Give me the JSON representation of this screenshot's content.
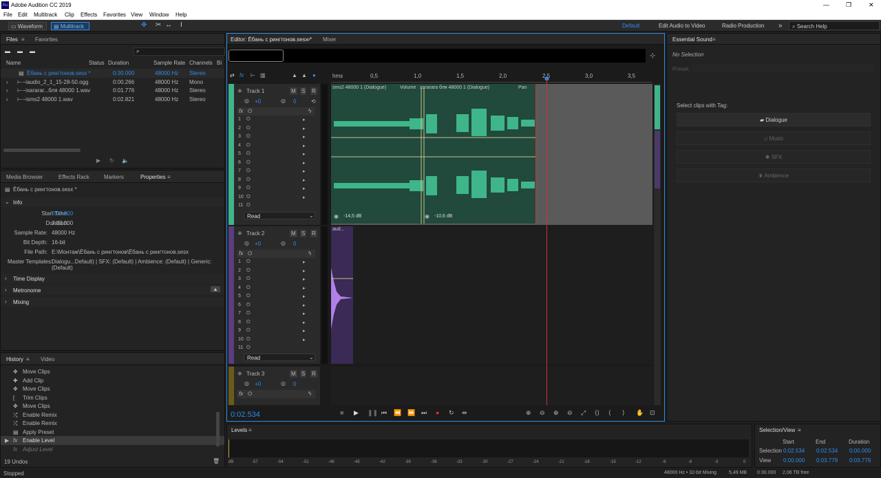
{
  "app": {
    "title": "Adobe Audition CC 2019",
    "logo_text": "Au",
    "window_controls": [
      "—",
      "❐",
      "✕"
    ]
  },
  "menu": [
    "File",
    "Edit",
    "Multitrack",
    "Clip",
    "Effects",
    "Favorites",
    "View",
    "Window",
    "Help"
  ],
  "toolbar": {
    "waveform": "Waveform",
    "multitrack": "Multitrack",
    "workspaces": [
      "Default",
      "Edit Audio to Video",
      "Radio Production"
    ],
    "more": "»",
    "search_placeholder": "Search Help"
  },
  "files": {
    "tabs": [
      "Files",
      "Favorites"
    ],
    "columns": [
      "Name",
      "Status",
      "Duration",
      "Sample Rate",
      "Channels",
      "Bi"
    ],
    "rows": [
      {
        "name": "Ёбань с рингтонов.sesx *",
        "duration": "0:30.000",
        "rate": "48000 Hz",
        "channels": "Stereo",
        "selected": true
      },
      {
        "name": "audio_2_1_15-28-50.ogg",
        "duration": "0:00.266",
        "rate": "48000 Hz",
        "channels": "Mono"
      },
      {
        "name": "хагаrаг...бля 48000 1.wav",
        "duration": "0:01.776",
        "rate": "48000 Hz",
        "channels": "Stereo"
      },
      {
        "name": "sms2 48000 1.wav",
        "duration": "0:02.821",
        "rate": "48000 Hz",
        "channels": "Stereo"
      }
    ]
  },
  "properties": {
    "tabs": [
      "Media Browser",
      "Effects Rack",
      "Markers",
      "Properties"
    ],
    "file": "Ёбань с рингтонов.sesx *",
    "section": "Info",
    "info": [
      [
        "Start Time:",
        "0:00.000"
      ],
      [
        "Duration:",
        "0:30.000"
      ],
      [
        "Sample Rate:",
        "48000 Hz"
      ],
      [
        "Bit Depth:",
        "16-bit"
      ],
      [
        "File Path:",
        "E:\\Монтаж\\Ёбань с рингтонов\\Ёбань с рингтонов.sesx"
      ],
      [
        "Master Templates:",
        "Dialogu...Default) | SFX: (Default) | Ambience: (Default) | Generic: (Default)"
      ]
    ],
    "collapsed": [
      "Time Display",
      "Metronome",
      "Mixing"
    ]
  },
  "history": {
    "tabs": [
      "History",
      "Video"
    ],
    "items": [
      "Move Clips",
      "Add Clip",
      "Move Clips",
      "Trim Clips",
      "Move Clips",
      "Enable Remix",
      "Enable Remix",
      "Apply Preset",
      "Enable Level",
      "Adjust Level"
    ],
    "undos": "19 Undos",
    "status": "Stopped"
  },
  "editor": {
    "tab": "Editor: Ёбань с рингтонов.sesx *",
    "mixer": "Mixer",
    "time": "0:02.534",
    "ruler": [
      "hms",
      "0,5",
      "1,0",
      "1,5",
      "2,0",
      "2,5",
      "3,0",
      "3,5"
    ],
    "tracks": [
      {
        "name": "Track 1",
        "vol": "+0",
        "pan": "0",
        "clip1": "sms2 48000 1 (Dialogue)",
        "volume_label": "Volume",
        "clip2": "хагаrаrа бля 48000 1 (Dialogue)",
        "pan_label": "Pan",
        "db1": "-14,5 dB",
        "db2": "-10,6 dB",
        "read": "Read"
      },
      {
        "name": "Track 2",
        "vol": "+0",
        "pan": "0",
        "clip1": "aud...",
        "read": "Read"
      },
      {
        "name": "Track 3",
        "vol": "+0",
        "pan": "0"
      }
    ],
    "rack": [
      "1",
      "2",
      "3",
      "4",
      "5",
      "6",
      "7",
      "8",
      "9",
      "10",
      "11"
    ],
    "msr": [
      "M",
      "S",
      "R",
      "I"
    ]
  },
  "essential": {
    "title": "Essential Sound",
    "no_selection": "No Selection",
    "preset": "Preset:",
    "prompt": "Select clips with Tag:",
    "tags": [
      "Dialogue",
      "Music",
      "SFX",
      "Ambience"
    ]
  },
  "levels": {
    "title": "Levels",
    "scale": [
      "dB",
      "-57",
      "-54",
      "-51",
      "-48",
      "-45",
      "-42",
      "-39",
      "-36",
      "-33",
      "-30",
      "-27",
      "-24",
      "-21",
      "-18",
      "-15",
      "-12",
      "-9",
      "-6",
      "-3",
      "0"
    ]
  },
  "selview": {
    "title": "Selection/View",
    "cols": [
      "Start",
      "End",
      "Duration"
    ],
    "rows": [
      [
        "Selection",
        "0:02.534",
        "0:02.534",
        "0:00.000"
      ],
      [
        "View",
        "0:00.000",
        "0:03.779",
        "0:03.779"
      ]
    ]
  },
  "statusbar": [
    "48000 Hz • 32-bit Mixing",
    "5,49 MB",
    "0:30.000",
    "2,06 TB free"
  ],
  "colors": {
    "accent": "#2d8ceb",
    "track1": "#3fb58a",
    "track2": "#9a6bd8",
    "clip1": "#21493c",
    "record": "#e03030"
  }
}
